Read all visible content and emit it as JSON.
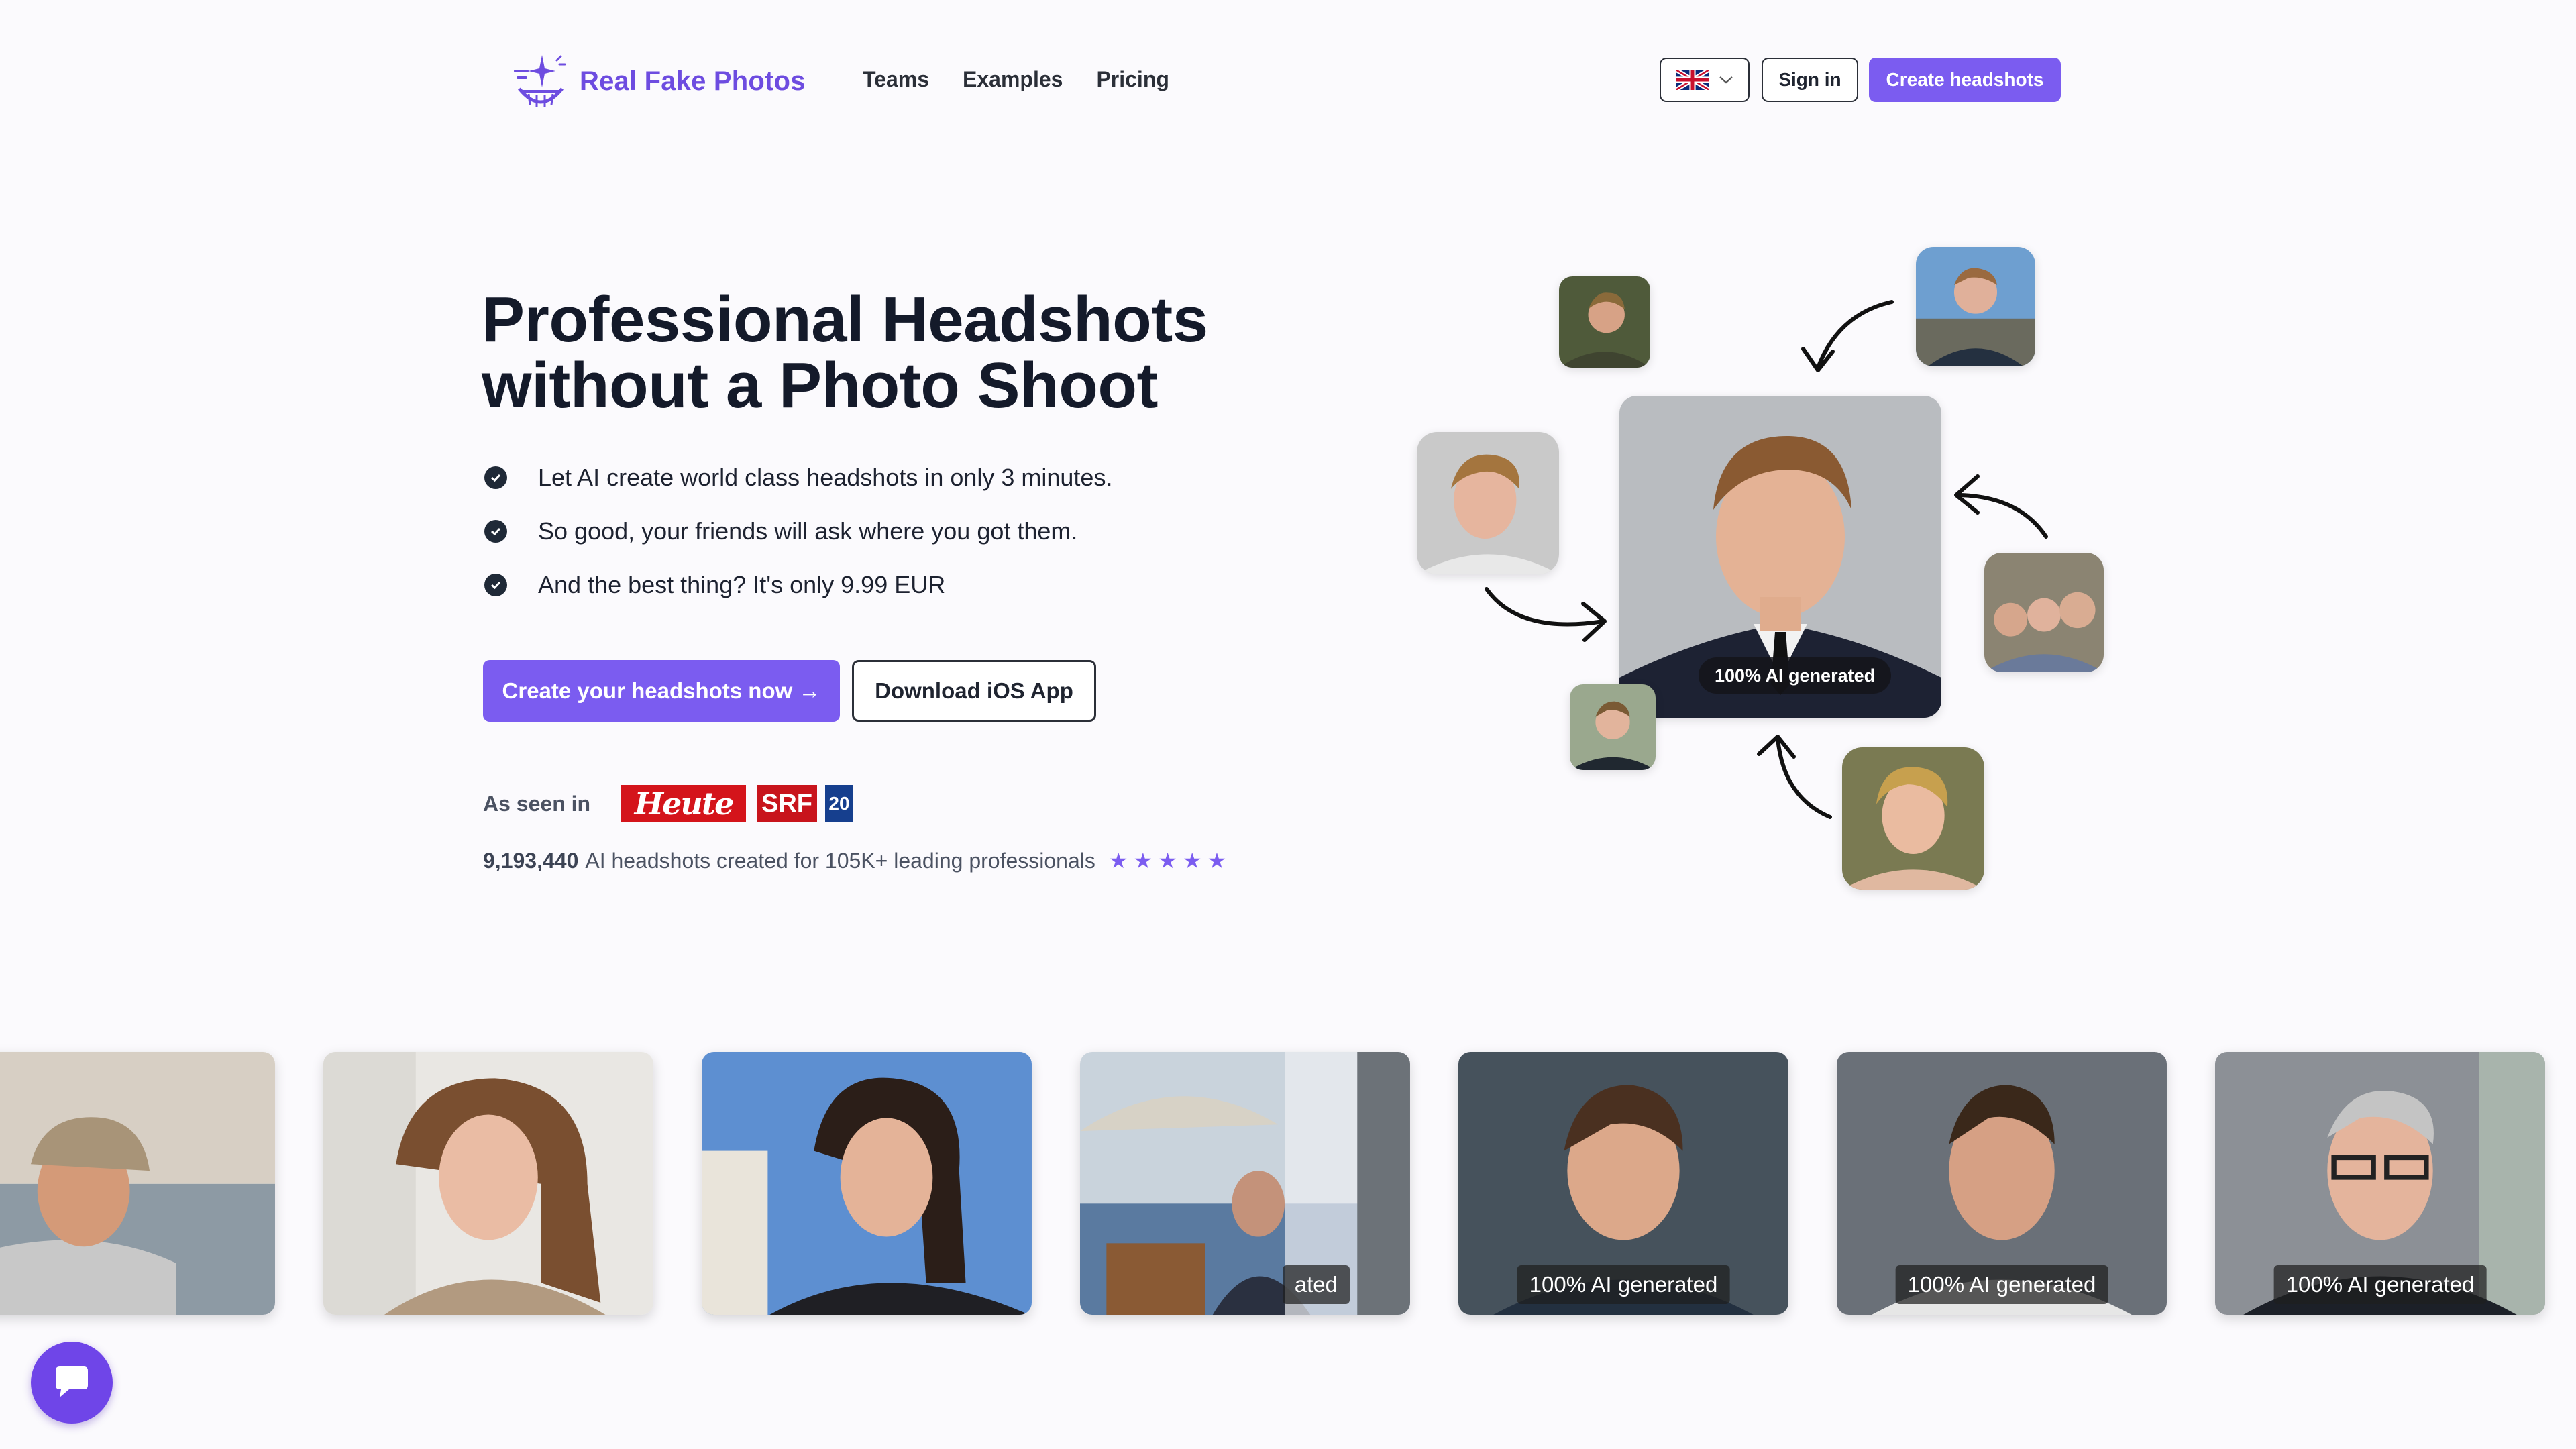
{
  "brand": {
    "name": "Real Fake Photos",
    "accent": "#7b5cf0"
  },
  "nav": {
    "items": [
      "Teams",
      "Examples",
      "Pricing"
    ]
  },
  "header": {
    "sign_in": "Sign in",
    "create": "Create headshots",
    "language_icon": "uk-flag-icon"
  },
  "hero": {
    "title_line1": "Professional Headshots",
    "title_line2": "without a Photo Shoot",
    "bullets": [
      "Let AI create world class headshots in only 3 minutes.",
      "So good, your friends will ask where you got them.",
      "And the best thing? It's only 9.99 EUR"
    ],
    "cta_primary": "Create your headshots now →",
    "cta_secondary": "Download iOS App",
    "seen_in_label": "As seen in",
    "press": [
      "Heute",
      "SRF",
      "20"
    ],
    "stats_count": "9,193,440",
    "stats_text": "AI headshots created for 105K+ leading professionals",
    "rating_stars": 5
  },
  "collage": {
    "badge": "100% AI generated"
  },
  "gallery": {
    "cards": [
      {
        "label": ""
      },
      {
        "label": ""
      },
      {
        "label": ""
      },
      {
        "label": "ated"
      },
      {
        "label": "100% AI generated"
      },
      {
        "label": "100% AI generated"
      },
      {
        "label": "100% AI generated"
      }
    ]
  },
  "chat": {
    "icon": "chat-bubble-icon"
  }
}
